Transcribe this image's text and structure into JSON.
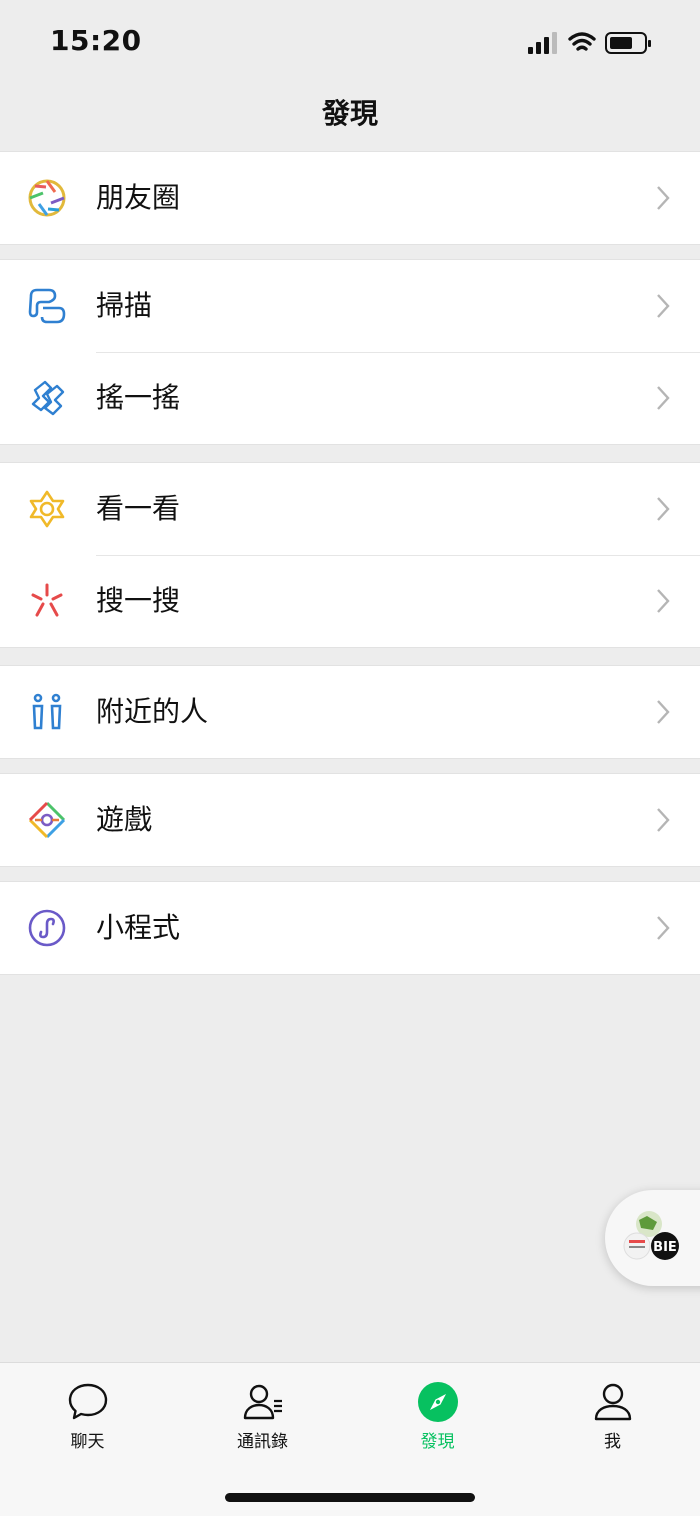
{
  "status": {
    "time": "15:20"
  },
  "nav": {
    "title": "發現"
  },
  "groups": [
    [
      {
        "label": "朋友圈",
        "icon": "moments-aperture-icon"
      }
    ],
    [
      {
        "label": "掃描",
        "icon": "scan-icon"
      },
      {
        "label": "搖一搖",
        "icon": "shake-icon"
      }
    ],
    [
      {
        "label": "看一看",
        "icon": "top-stories-icon"
      },
      {
        "label": "搜一搜",
        "icon": "search-sparkle-icon"
      }
    ],
    [
      {
        "label": "附近的人",
        "icon": "people-nearby-icon"
      }
    ],
    [
      {
        "label": "遊戲",
        "icon": "games-icon"
      }
    ],
    [
      {
        "label": "小程式",
        "icon": "mini-programs-icon"
      }
    ]
  ],
  "tabs": [
    {
      "label": "聊天",
      "icon": "chat-bubble-icon",
      "active": false
    },
    {
      "label": "通訊錄",
      "icon": "contacts-icon",
      "active": false
    },
    {
      "label": "發現",
      "icon": "compass-icon",
      "active": true
    },
    {
      "label": "我",
      "icon": "person-icon",
      "active": false
    }
  ],
  "colors": {
    "accent": "#07c160",
    "background": "#ededed"
  }
}
